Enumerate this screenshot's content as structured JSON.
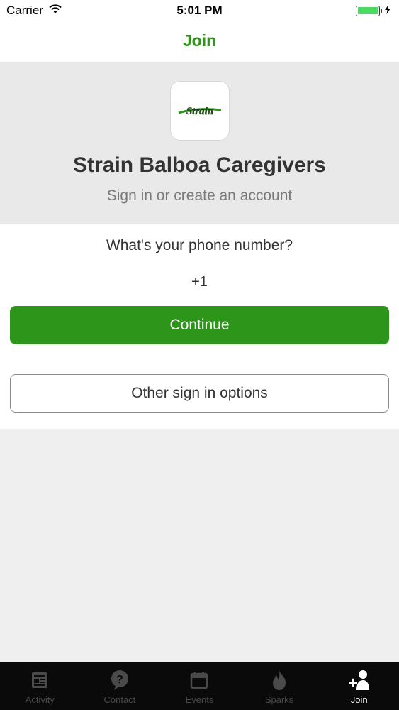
{
  "status_bar": {
    "carrier": "Carrier",
    "time": "5:01 PM"
  },
  "navbar": {
    "title": "Join"
  },
  "hero": {
    "logo_text": "Strain",
    "org_name": "Strain Balboa Caregivers",
    "subtitle": "Sign in or create an account"
  },
  "form": {
    "question": "What's your phone number?",
    "phone_value": "+1",
    "continue_label": "Continue",
    "other_label": "Other sign in options"
  },
  "tabbar": {
    "items": [
      {
        "label": "Activity",
        "icon": "activity-icon"
      },
      {
        "label": "Contact",
        "icon": "help-icon"
      },
      {
        "label": "Events",
        "icon": "calendar-icon"
      },
      {
        "label": "Sparks",
        "icon": "flame-icon"
      },
      {
        "label": "Join",
        "icon": "add-user-icon",
        "active": true
      }
    ]
  },
  "colors": {
    "brand_green": "#2e951b",
    "tabbar_bg": "#0a0a0a",
    "battery_green": "#4cd964"
  }
}
